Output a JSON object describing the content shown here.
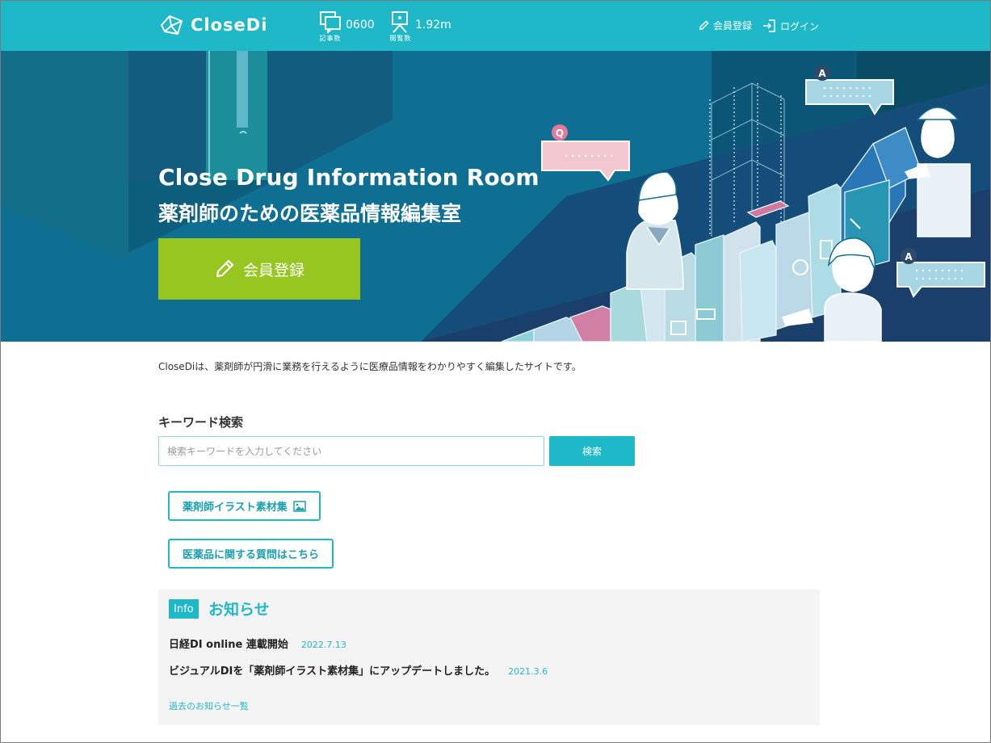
{
  "header": {
    "logo_text": "CloseDi",
    "stats": [
      {
        "icon": "articles-icon",
        "caption": "記事数",
        "value": "0600"
      },
      {
        "icon": "views-icon",
        "caption": "閲覧数",
        "value": "1.92m"
      }
    ],
    "register_label": "会員登録",
    "login_label": "ログイン"
  },
  "hero": {
    "title": "Close Drug Information Room",
    "subtitle": "薬剤師のための医薬品情報編集室",
    "register_button": "会員登録",
    "bubble_q": "Q",
    "bubble_a": "A"
  },
  "intro": "CloseDiは、薬剤師が円滑に業務を行えるように医療品情報をわかりやすく編集したサイトです。",
  "search": {
    "title": "キーワード検索",
    "placeholder": "検索キーワードを入力してください",
    "button": "検索"
  },
  "links": {
    "illustration": "薬剤師イラスト素材集",
    "question": "医薬品に関する質問はこちら"
  },
  "info": {
    "badge": "Info",
    "title": "お知らせ",
    "items": [
      {
        "title": "日経DI online 連載開始",
        "date": "2022.7.13"
      },
      {
        "title": "ビジュアルDIを「薬剤師イラスト素材集」にアップデートしました。",
        "date": "2021.3.6"
      }
    ],
    "past_link": "過去のお知らせ一覧"
  },
  "colors": {
    "accent": "#1fb8c8",
    "cta": "#96c61f",
    "hero_bg": "#0e6f93"
  }
}
